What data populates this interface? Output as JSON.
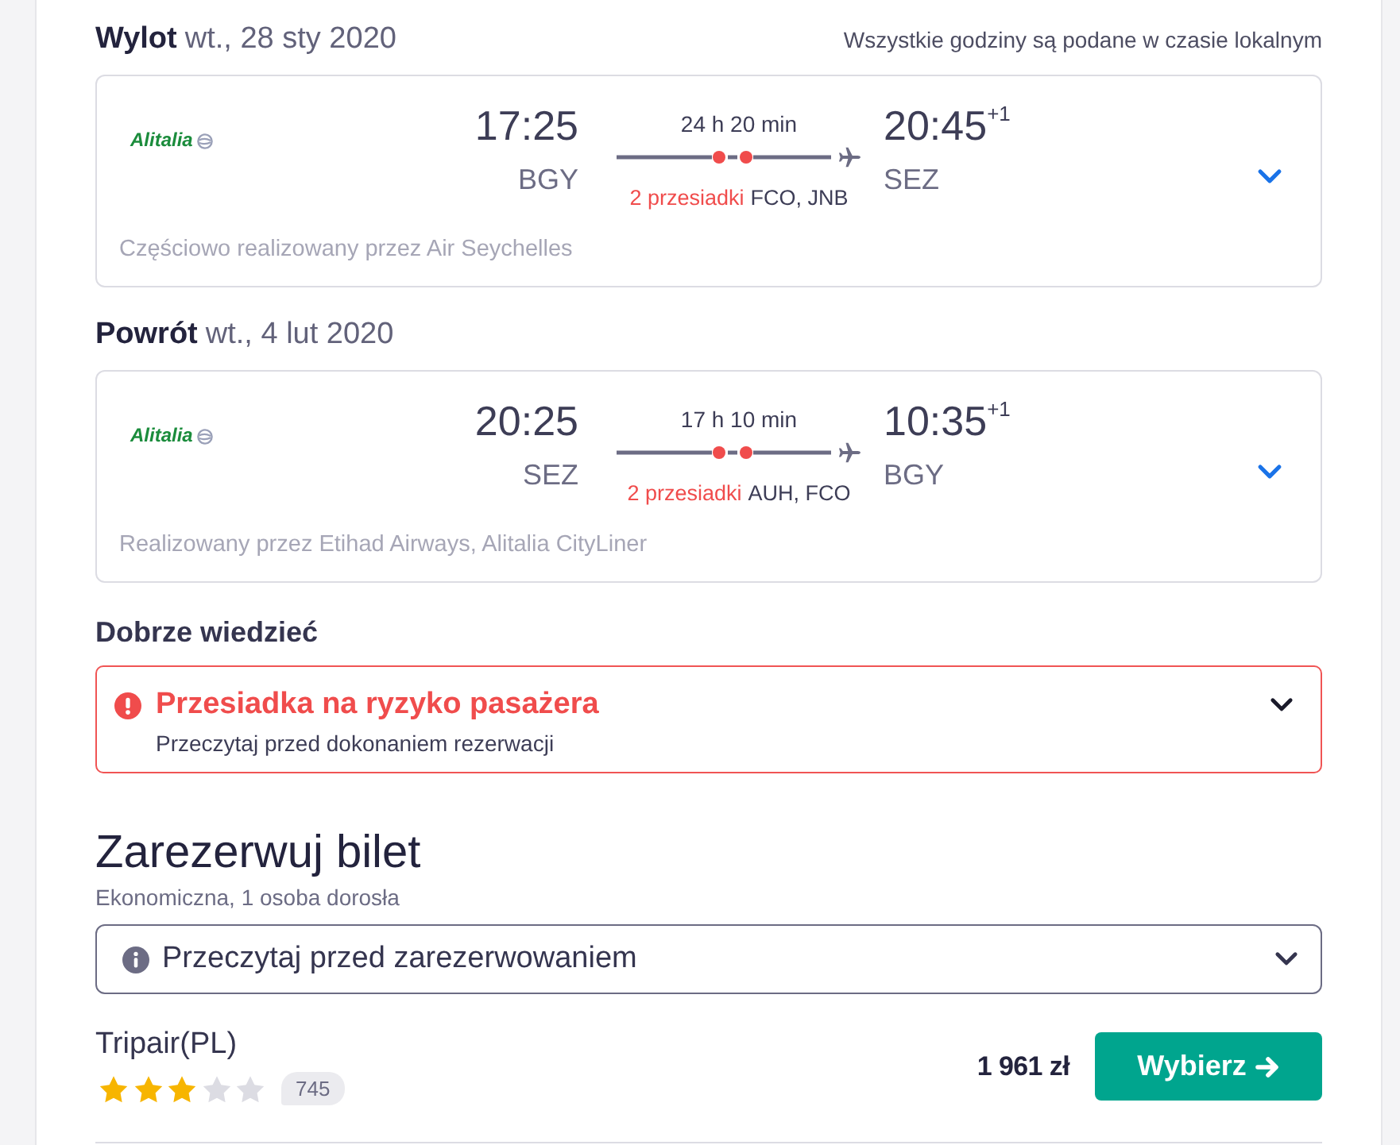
{
  "timezone_note": "Wszystkie godziny są podane w czasie lokalnym",
  "legs": [
    {
      "label": "Wylot",
      "date": "wt., 28 sty 2020",
      "airline_logo": "Alitalia",
      "departure": {
        "time": "17:25",
        "airport": "BGY"
      },
      "duration": "24 h 20 min",
      "stops": "2 przesiadki",
      "stop_airports": "FCO, JNB",
      "arrival": {
        "time": "20:45",
        "day_offset": "+1",
        "airport": "SEZ"
      },
      "operated_by": "Częściowo realizowany przez Air Seychelles",
      "expanded": false
    },
    {
      "label": "Powrót",
      "date": "wt., 4 lut 2020",
      "airline_logo": "Alitalia",
      "departure": {
        "time": "20:25",
        "airport": "SEZ"
      },
      "duration": "17 h 10 min",
      "stops": "2 przesiadki",
      "stop_airports": "AUH, FCO",
      "arrival": {
        "time": "10:35",
        "day_offset": "+1",
        "airport": "BGY"
      },
      "operated_by": "Realizowany przez Etihad Airways, Alitalia CityLiner",
      "expanded": false
    }
  ],
  "good_to_know": {
    "title": "Dobrze wiedzieć",
    "alert": {
      "title": "Przesiadka na ryzyko pasażera",
      "text": "Przeczytaj przed dokonaniem rezerwacji",
      "expanded": false
    }
  },
  "booking": {
    "title": "Zarezerwuj bilet",
    "subtitle": "Ekonomiczna, 1 osoba dorosła",
    "notice": {
      "label": "Przeczytaj przed zarezerwowaniem",
      "expanded": false
    },
    "offers": [
      {
        "provider": "Tripair(PL)",
        "stars": 3,
        "reviews": "745",
        "price": "1 961 zł",
        "button": "Wybierz"
      }
    ]
  }
}
